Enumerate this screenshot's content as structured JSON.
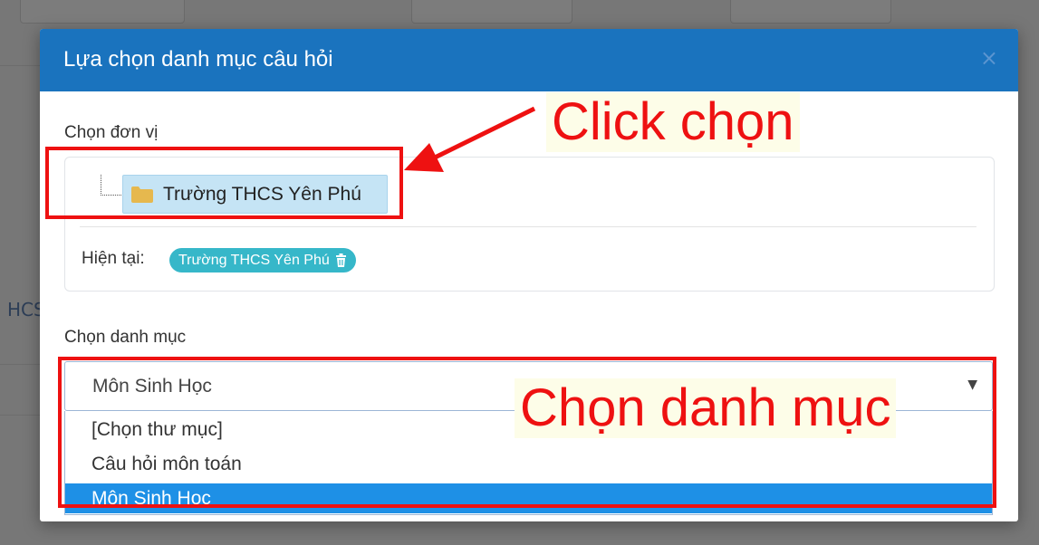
{
  "modal": {
    "title": "Lựa chọn danh mục câu hỏi",
    "close_glyph": "×",
    "unit_label": "Chọn đơn vị",
    "tree_node": "Trường THCS Yên Phú",
    "current_label": "Hiện tại:",
    "current_value": "Trường THCS Yên Phú",
    "category_label": "Chọn danh mục",
    "category_selected": "Môn Sinh Học",
    "category_options": [
      "[Chọn thư mục]",
      "Câu hỏi môn toán",
      "Môn Sinh Hoc"
    ],
    "selected_index": 2
  },
  "background": {
    "partial_text": "HCS"
  },
  "annotations": {
    "callout_1": "Click chọn",
    "callout_2": "Chọn danh mục",
    "color": "#ee1111"
  },
  "colors": {
    "header": "#1a73be",
    "badge": "#36b7c9",
    "node_highlight": "#c5e4f5",
    "option_selected": "#1e90e6",
    "folder": "#e6b84e"
  },
  "icons": [
    "folder-icon",
    "trash-icon",
    "close-icon",
    "caret-down-icon",
    "arrow-icon"
  ]
}
